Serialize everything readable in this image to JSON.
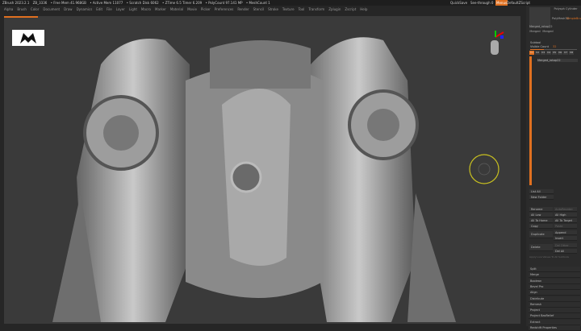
{
  "titlebar": {
    "app": "ZBrush 2023.2.1",
    "id": "ZB_3336",
    "free_mem": "• Free Mem 41.968GB",
    "active_mem": "• Active Mem 11077",
    "scratch": "• Scratch Disk 6062",
    "ztime": "• ZTime 6.5 Timer 6.209",
    "polycount": "• PolyCount 97.141 MP",
    "meshcount": "• MeshCount 1",
    "quicksave": "QuickSave",
    "seethrough": "See-through 0",
    "menus": "Menus",
    "zscript": "DefaultZScript"
  },
  "menu": [
    "Alpha",
    "Brush",
    "Color",
    "Document",
    "Draw",
    "Dynamics",
    "Edit",
    "File",
    "Layer",
    "Light",
    "Macro",
    "Marker",
    "Material",
    "Movie",
    "Picker",
    "Preferences",
    "Render",
    "Stencil",
    "Stroke",
    "Texture",
    "Tool",
    "Transform",
    "Zplugin",
    "Zscript",
    "Help"
  ],
  "tool_thumbs": [
    "Merged_rotop22",
    "PolyMesh3D",
    "SimpleBrush",
    "Merged",
    "Merged",
    "Polysph Cylinder"
  ],
  "subtool": {
    "title": "Subtool",
    "visible_count_label": "Visible Count",
    "visible_count": "32",
    "visible_fraction": 0.3,
    "slots": [
      "V1",
      "V2",
      "V3",
      "V4",
      "V5",
      "V6",
      "V7",
      "V8"
    ],
    "item": "Merged_rotop22"
  },
  "buttons": {
    "list_all": "List All",
    "new_folder": "New Folder",
    "rename": "Rename",
    "auto_reorder": "AutoReorder",
    "all_low": "All Low",
    "all_high": "All High",
    "all_to_home": "All To Home",
    "all_to_target": "All To Target",
    "copy": "Copy",
    "paste": "Paste",
    "duplicate": "Duplicate",
    "append": "Append",
    "insert": "Insert",
    "delete": "Delete",
    "del_other": "Del Other",
    "del_all": "Del All",
    "apply_live": "Apply Live Values To All Subtools"
  },
  "sections": [
    "Split",
    "Merge",
    "Boolean",
    "Bevel Pro",
    "Align",
    "Distribute",
    "Remesh",
    "Project",
    "Project BasRelief",
    "Extract",
    "Redshift Properties"
  ],
  "colors": {
    "accent": "#e07020",
    "bg": "#262626",
    "viewport": "#3a3a3a"
  }
}
